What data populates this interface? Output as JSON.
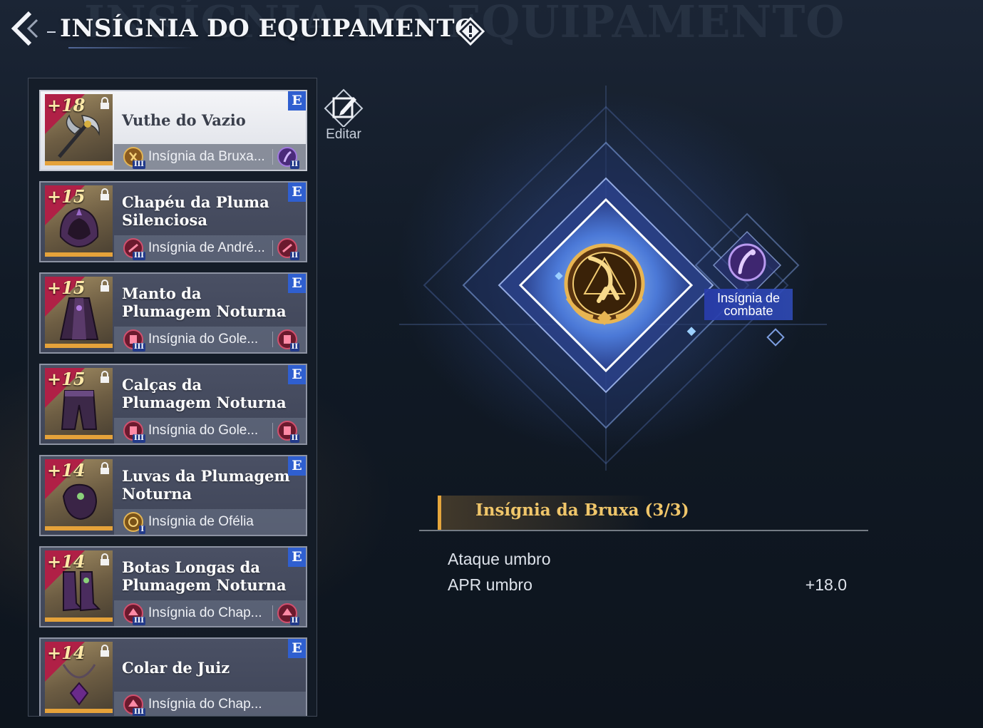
{
  "header": {
    "title": "INSÍGNIA DO EQUIPAMENTO",
    "bg_title": "INSÍGNIA DO EQUIPAMENTO",
    "back_icon": "back-arrow-icon",
    "info_icon": "alert-diamond-icon"
  },
  "edit": {
    "label": "Editar",
    "icon": "edit-icon"
  },
  "colors": {
    "grade_badge": "#2f5fd0",
    "accent_gold": "#e6a63c",
    "level_corner": "#b02046",
    "thumb_border": "#e5a23a"
  },
  "equipment": [
    {
      "level": "+18",
      "name": "Vuthe do Vazio",
      "grade": "E",
      "insignia": "Insígnia da Bruxa...",
      "icon1": "witch-insignia-icon",
      "tier1": "III",
      "icon2": "combat-insignia-icon",
      "tier2": "II",
      "selected": true
    },
    {
      "level": "+15",
      "name": "Chapéu da Pluma Silenciosa",
      "grade": "E",
      "insignia": "Insígnia de André...",
      "icon1": "red-insignia-icon",
      "tier1": "III",
      "icon2": "red-insignia-icon",
      "tier2": "II",
      "selected": false
    },
    {
      "level": "+15",
      "name": "Manto da Plumagem Noturna",
      "grade": "E",
      "insignia": "Insígnia do Gole...",
      "icon1": "golem-insignia-icon",
      "tier1": "III",
      "icon2": "golem-insignia-icon",
      "tier2": "II",
      "selected": false
    },
    {
      "level": "+15",
      "name": "Calças da Plumagem Noturna",
      "grade": "E",
      "insignia": "Insígnia do Gole...",
      "icon1": "golem-insignia-icon",
      "tier1": "III",
      "icon2": "golem-insignia-icon",
      "tier2": "II",
      "selected": false
    },
    {
      "level": "+14",
      "name": "Luvas da Plumagem Noturna",
      "grade": "E",
      "insignia": "Insígnia de Ofélia",
      "icon1": "ophelia-insignia-icon",
      "tier1": "I",
      "icon2": "",
      "tier2": "",
      "selected": false
    },
    {
      "level": "+14",
      "name": "Botas Longas da Plumagem Noturna",
      "grade": "E",
      "insignia": "Insígnia do Chap...",
      "icon1": "hat-insignia-icon",
      "tier1": "III",
      "icon2": "hat-insignia-icon",
      "tier2": "II",
      "selected": false
    },
    {
      "level": "+14",
      "name": "Colar de Juiz",
      "grade": "E",
      "insignia": "Insígnia do Chap...",
      "icon1": "hat-insignia-icon",
      "tier1": "III",
      "icon2": "",
      "tier2": "",
      "selected": false
    }
  ],
  "insignia_board": {
    "main_icon": "witch-claw-insignia-icon",
    "side_icon": "combat-insignia-icon",
    "side_label": "Insígnia de combate"
  },
  "detail": {
    "title": "Insígnia da Bruxa (3/3)",
    "stats": [
      {
        "label": "Ataque umbro",
        "value": ""
      },
      {
        "label": "APR umbro",
        "value": "+18.0"
      }
    ]
  }
}
